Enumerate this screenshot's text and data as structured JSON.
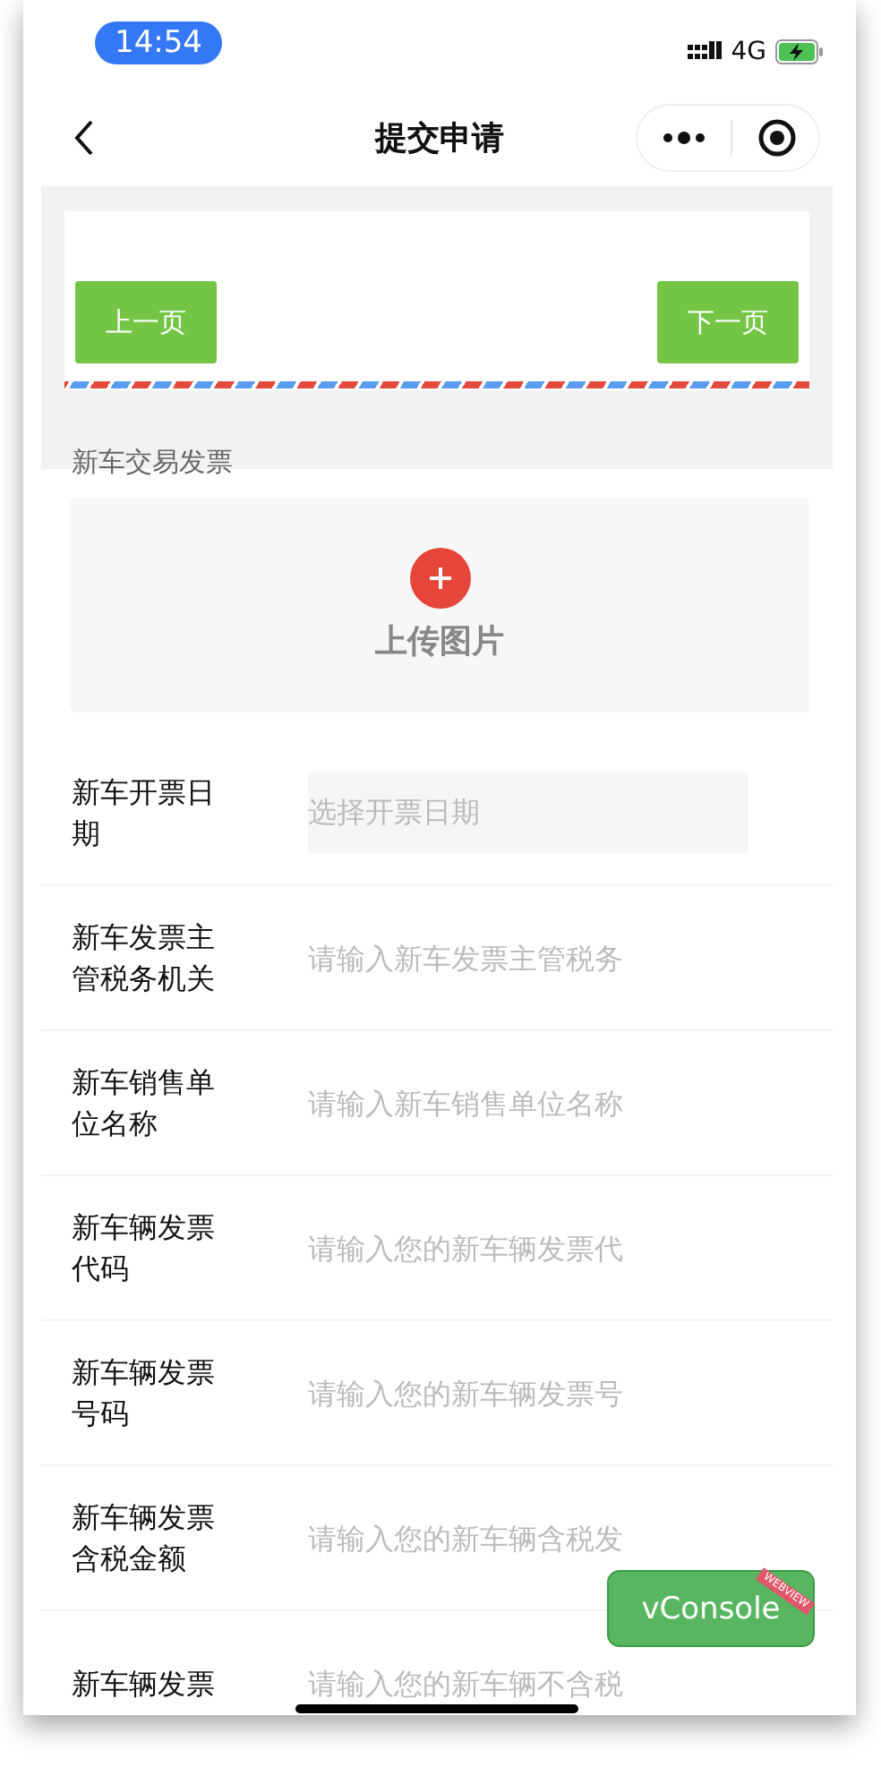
{
  "status_bar": {
    "time": "14:54",
    "network": "4G"
  },
  "nav": {
    "title": "提交申请"
  },
  "pager": {
    "prev": "上一页",
    "next": "下一页"
  },
  "section_title": "新车交易发票",
  "upload": {
    "label": "上传图片"
  },
  "fields": [
    {
      "kind": "picker",
      "label": "新车开票日期",
      "placeholder": "选择开票日期"
    },
    {
      "kind": "text",
      "label": "新车发票主管税务机关",
      "placeholder": "请输入新车发票主管税务"
    },
    {
      "kind": "text",
      "label": "新车销售单位名称",
      "placeholder": "请输入新车销售单位名称"
    },
    {
      "kind": "text",
      "label": "新车辆发票代码",
      "placeholder": "请输入您的新车辆发票代"
    },
    {
      "kind": "text",
      "label": "新车辆发票号码",
      "placeholder": "请输入您的新车辆发票号"
    },
    {
      "kind": "text",
      "label": "新车辆发票含税金额",
      "placeholder": "请输入您的新车辆含税发"
    },
    {
      "kind": "text",
      "label": "新车辆发票",
      "placeholder": "请输入您的新车辆不含税"
    }
  ],
  "vconsole": {
    "label": "vConsole",
    "ribbon": "WEBVIEW"
  }
}
